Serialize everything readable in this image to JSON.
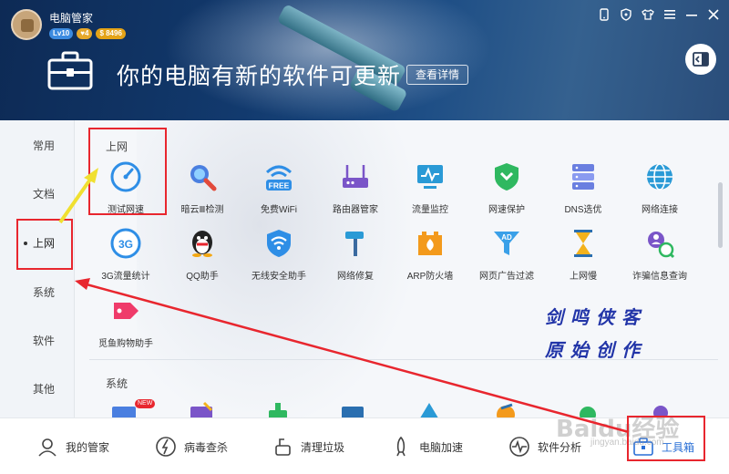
{
  "header": {
    "app_name": "电脑管家",
    "badges": {
      "level": "Lv10",
      "heart": "♥4",
      "money": "$ 8496"
    },
    "headline": "你的电脑有新的软件可更新",
    "details_button": "查看详情"
  },
  "sidebar": {
    "items": [
      {
        "label": "常用"
      },
      {
        "label": "文档"
      },
      {
        "label": "上网"
      },
      {
        "label": "系统"
      },
      {
        "label": "软件"
      },
      {
        "label": "其他"
      }
    ],
    "active": "上网"
  },
  "sections": {
    "internet_title": "上网",
    "system_title": "系统"
  },
  "tools": [
    {
      "label": "测试网速",
      "icon": "speedometer-icon"
    },
    {
      "label": "暗云Ⅲ检测",
      "icon": "magnifier-icon"
    },
    {
      "label": "免费WiFi",
      "icon": "free-wifi-icon"
    },
    {
      "label": "路由器管家",
      "icon": "router-icon"
    },
    {
      "label": "流量监控",
      "icon": "monitor-icon"
    },
    {
      "label": "网速保护",
      "icon": "shield-icon"
    },
    {
      "label": "DNS选优",
      "icon": "server-icon"
    },
    {
      "label": "网络连接",
      "icon": "globe-icon"
    },
    {
      "label": "3G流量统计",
      "icon": "3g-icon"
    },
    {
      "label": "QQ助手",
      "icon": "qq-penguin-icon"
    },
    {
      "label": "无线安全助手",
      "icon": "wifi-shield-icon"
    },
    {
      "label": "网络修复",
      "icon": "hammer-icon"
    },
    {
      "label": "ARP防火墙",
      "icon": "firewall-icon"
    },
    {
      "label": "网页广告过滤",
      "icon": "ad-filter-icon"
    },
    {
      "label": "上网慢",
      "icon": "hourglass-icon"
    },
    {
      "label": "诈骗信息查询",
      "icon": "fraud-search-icon"
    },
    {
      "label": "觅鱼购物助手",
      "icon": "shopping-tag-icon"
    }
  ],
  "new_badge": "NEW",
  "signature": {
    "line1": "剑鸣侠客",
    "line2": "原始创作"
  },
  "bottom_nav": [
    {
      "label": "我的管家",
      "icon": "avatar-outline-icon"
    },
    {
      "label": "病毒查杀",
      "icon": "virus-scan-icon"
    },
    {
      "label": "清理垃圾",
      "icon": "broom-icon"
    },
    {
      "label": "电脑加速",
      "icon": "rocket-icon"
    },
    {
      "label": "软件分析",
      "icon": "pulse-icon"
    },
    {
      "label": "工具箱",
      "icon": "toolbox-icon"
    }
  ],
  "watermark": {
    "brand": "Baidu经验",
    "url": "jingyan.baidu.com"
  },
  "colors": {
    "annotation": "#e8262e",
    "arrow": "#f0e030",
    "signature": "#2235a8"
  }
}
